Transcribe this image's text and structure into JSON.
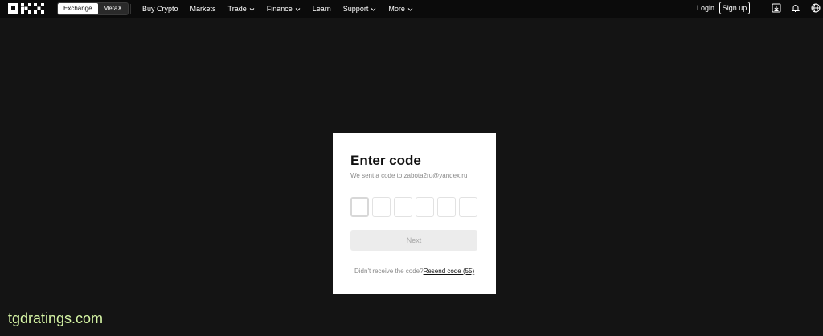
{
  "header": {
    "logo_text": "OKX",
    "switch": {
      "active": "Exchange",
      "inactive": "MetaX"
    },
    "nav": [
      {
        "label": "Buy Crypto",
        "has_dropdown": false
      },
      {
        "label": "Markets",
        "has_dropdown": false
      },
      {
        "label": "Trade",
        "has_dropdown": true
      },
      {
        "label": "Finance",
        "has_dropdown": true
      },
      {
        "label": "Learn",
        "has_dropdown": false
      },
      {
        "label": "Support",
        "has_dropdown": true
      },
      {
        "label": "More",
        "has_dropdown": true
      }
    ],
    "login_label": "Login",
    "signup_label": "Sign up",
    "icons": [
      "download-icon",
      "bell-icon",
      "globe-icon"
    ]
  },
  "dialog": {
    "title": "Enter code",
    "subtitle": "We sent a code to zabota2ru@yandex.ru",
    "code_digits": [
      "",
      "",
      "",
      "",
      "",
      ""
    ],
    "next_label": "Next",
    "resend_prompt": "Didn't receive the code?",
    "resend_link": "Resend code (55)"
  },
  "watermark": "tgdratings.com",
  "colors": {
    "background": "#141414",
    "card": "#ffffff",
    "button_disabled": "#ececec",
    "watermark": "#d7f6a6"
  }
}
